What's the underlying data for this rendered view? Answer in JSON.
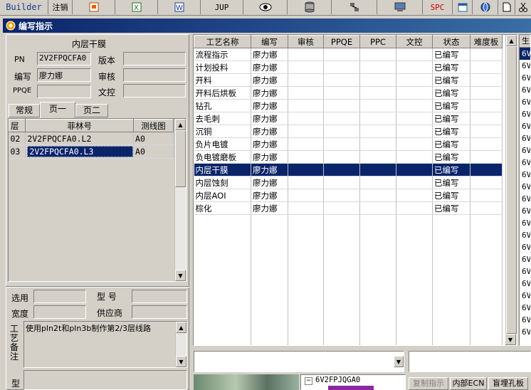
{
  "toolbar": {
    "builder": "Builder",
    "logout": "注销",
    "jup": "JUP",
    "spc": "SPC"
  },
  "window": {
    "title": "编写指示"
  },
  "left": {
    "section_title": "内层干膜",
    "labels": {
      "pn": "PN",
      "version": "版本",
      "author": "编写",
      "review": "审核",
      "ppqe": "PPQE",
      "doc_control": "文控"
    },
    "values": {
      "pn": "2V2FPQCFA0",
      "author": "廖力娜",
      "version": "",
      "review": "",
      "ppqe": "",
      "doc_control": ""
    },
    "tabs": [
      "常规",
      "页一",
      "页二"
    ],
    "layer_table": {
      "headers": [
        "层",
        "菲林号",
        "测线图"
      ],
      "rows": [
        [
          "02",
          "2V2FPQCFA0.L2",
          "A0"
        ],
        [
          "03",
          "2V2FPQCFA0.L3",
          "A0"
        ]
      ],
      "selected_index": 1
    },
    "bottom_labels": {
      "select": "选用",
      "model": "型 号",
      "width": "宽度",
      "supplier": "供应商"
    },
    "remark_label": "工艺备注",
    "remark_text": "使用pln2t和pln3b制作第2/3层线路",
    "bottom_label2": "型"
  },
  "process_grid": {
    "headers": [
      "工艺名称",
      "编写",
      "审核",
      "PPQE",
      "PPC",
      "文控",
      "状态",
      "难度板"
    ],
    "rows": [
      [
        "流程指示",
        "廖力娜",
        "",
        "",
        "",
        "",
        "已编写",
        ""
      ],
      [
        "计划投料",
        "廖力娜",
        "",
        "",
        "",
        "",
        "已编写",
        ""
      ],
      [
        "开料",
        "廖力娜",
        "",
        "",
        "",
        "",
        "已编写",
        ""
      ],
      [
        "开料后烘板",
        "廖力娜",
        "",
        "",
        "",
        "",
        "已编写",
        ""
      ],
      [
        "钻孔",
        "廖力娜",
        "",
        "",
        "",
        "",
        "已编写",
        ""
      ],
      [
        "去毛刺",
        "廖力娜",
        "",
        "",
        "",
        "",
        "已编写",
        ""
      ],
      [
        "沉铜",
        "廖力娜",
        "",
        "",
        "",
        "",
        "已编写",
        ""
      ],
      [
        "负片电镀",
        "廖力娜",
        "",
        "",
        "",
        "",
        "已编写",
        ""
      ],
      [
        "负电镀磨板",
        "廖力娜",
        "",
        "",
        "",
        "",
        "已编写",
        ""
      ],
      [
        "内层干膜",
        "廖力娜",
        "",
        "",
        "",
        "",
        "已编写",
        ""
      ],
      [
        "内层蚀刻",
        "廖力娜",
        "",
        "",
        "",
        "",
        "已编写",
        ""
      ],
      [
        "内层AOI",
        "廖力娜",
        "",
        "",
        "",
        "",
        "已编写",
        ""
      ],
      [
        "棕化",
        "廖力娜",
        "",
        "",
        "",
        "",
        "已编写",
        ""
      ]
    ],
    "selected_index": 9
  },
  "right_partial": {
    "header": "生",
    "items": [
      "6V",
      "6V",
      "6V",
      "6V",
      "6V",
      "6V",
      "6V",
      "6V",
      "6V",
      "6V",
      "6V",
      "6V",
      "6V",
      "6V",
      "6V",
      "6V",
      "6V",
      "6V",
      "6V",
      "6V",
      "6V",
      "6V",
      "6V",
      "6V"
    ]
  },
  "bottom": {
    "tree_item": "6V2FPJQGA0",
    "buttons": [
      "复制指示",
      "内部ECN",
      "盲埋孔板"
    ]
  },
  "colors": {
    "selection": "#0a246a",
    "title_bar": "#0a246a",
    "spc": "#cc0000"
  }
}
